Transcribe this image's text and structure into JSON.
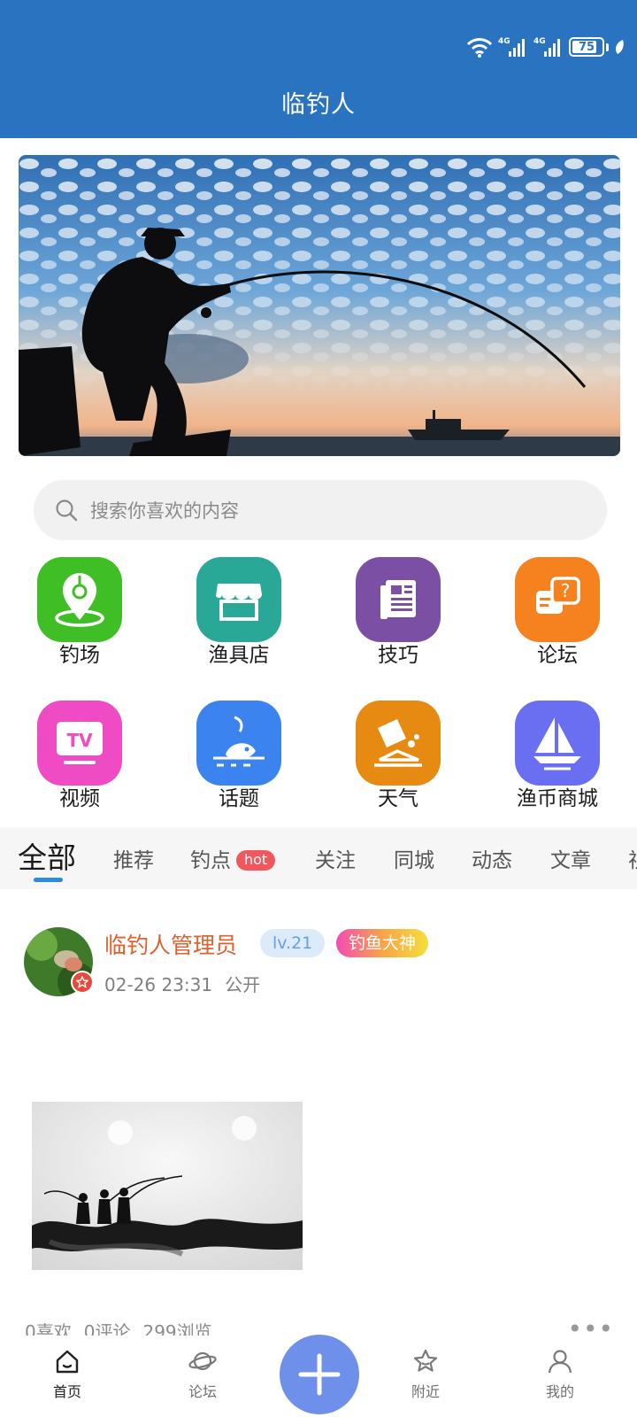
{
  "status": {
    "net1": "4G",
    "net2": "4G",
    "battery": "75"
  },
  "header": {
    "title": "临钓人"
  },
  "search": {
    "placeholder": "搜索你喜欢的内容"
  },
  "categories": [
    {
      "label": "钓场",
      "icon": "location-pin-icon",
      "color": "#3fbf25"
    },
    {
      "label": "渔具店",
      "icon": "store-icon",
      "color": "#2aa897"
    },
    {
      "label": "技巧",
      "icon": "document-icon",
      "color": "#7b4fa3"
    },
    {
      "label": "论坛",
      "icon": "chat-question-icon",
      "color": "#f5821f"
    },
    {
      "label": "视频",
      "icon": "tv-icon",
      "color": "#ef4bc4"
    },
    {
      "label": "话题",
      "icon": "fish-hook-icon",
      "color": "#3b84ef"
    },
    {
      "label": "天气",
      "icon": "weather-icon",
      "color": "#e68a12"
    },
    {
      "label": "渔币商城",
      "icon": "sailboat-icon",
      "color": "#6a6ff2"
    }
  ],
  "tabs": [
    {
      "label": "全部",
      "active": true
    },
    {
      "label": "推荐"
    },
    {
      "label": "钓点",
      "badge": "hot"
    },
    {
      "label": "关注"
    },
    {
      "label": "同城"
    },
    {
      "label": "动态"
    },
    {
      "label": "文章"
    },
    {
      "label": "视"
    }
  ],
  "post": {
    "username": "临钓人管理员",
    "level": "lv.21",
    "title_badge": "钓鱼大神",
    "time": "02-26 23:31",
    "visibility": "公开",
    "likes": "0喜欢",
    "comments": "0评论",
    "views": "299浏览",
    "more": "•••"
  },
  "nav": [
    {
      "label": "首页",
      "icon": "home-icon",
      "active": true
    },
    {
      "label": "论坛",
      "icon": "planet-icon"
    },
    {
      "label": "",
      "icon": "plus-icon"
    },
    {
      "label": "附近",
      "icon": "star-icon"
    },
    {
      "label": "我的",
      "icon": "user-icon"
    }
  ],
  "colors": {
    "header": "#2a73c1",
    "accent": "#2a8be0",
    "plus": "#6e90eb"
  }
}
